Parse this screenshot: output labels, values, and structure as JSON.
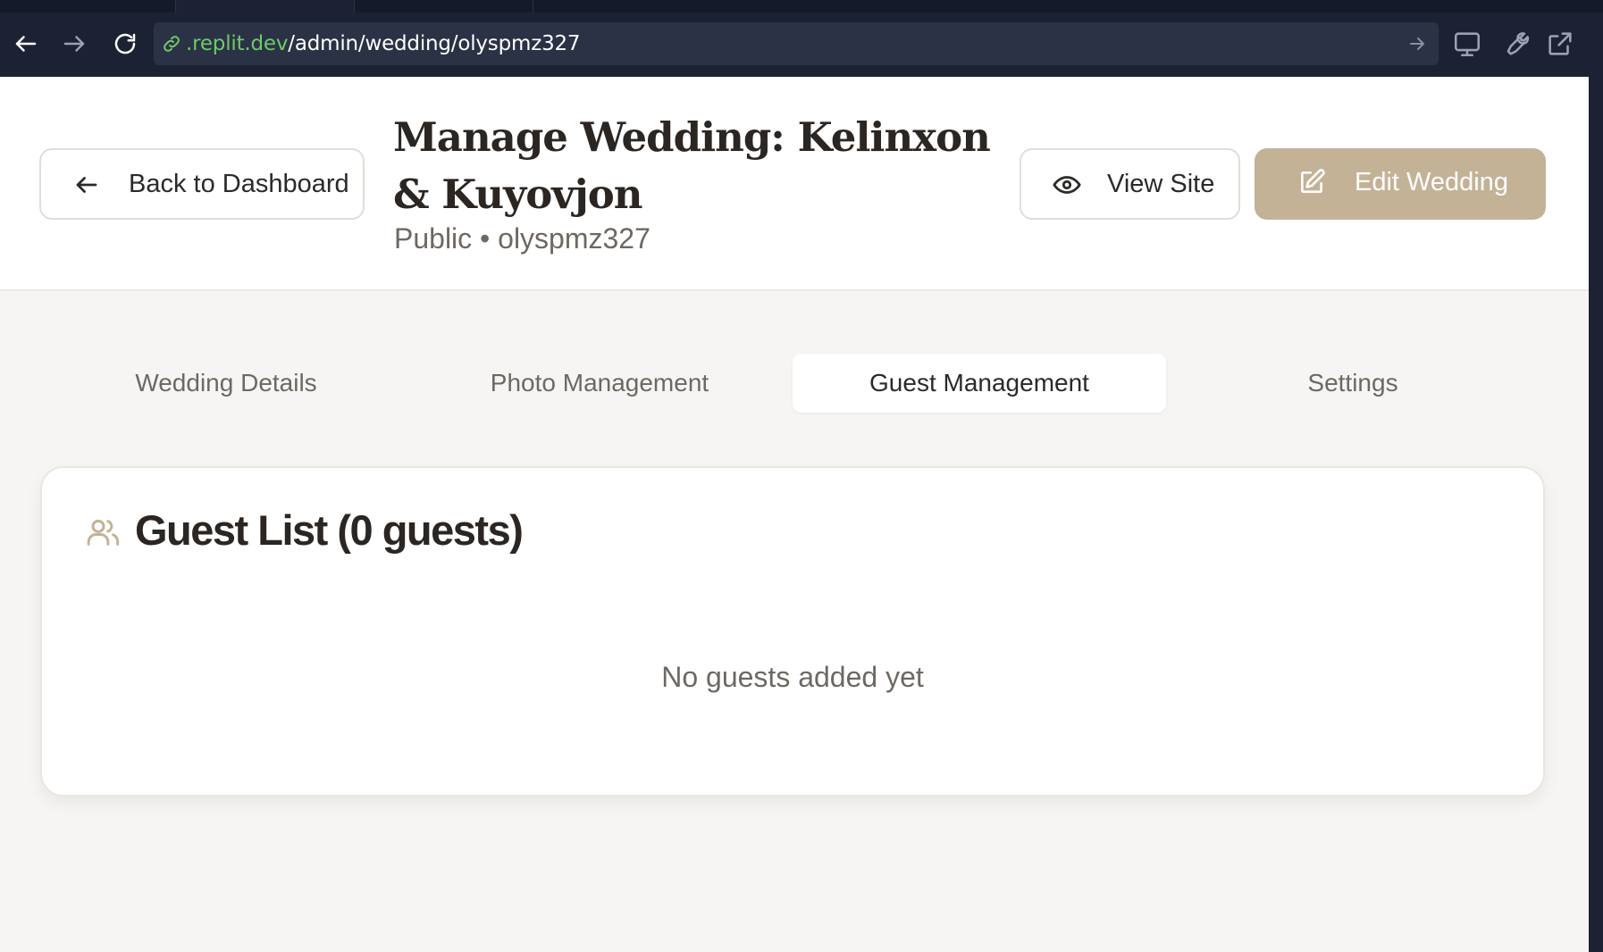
{
  "browser": {
    "url_domain": ".replit.dev",
    "url_path": "/admin/wedding/olyspmz327",
    "icons": [
      "back-arrow-icon",
      "forward-arrow-icon",
      "reload-icon",
      "link-icon",
      "go-arrow-icon",
      "monitor-icon",
      "wrench-icon",
      "external-link-icon"
    ]
  },
  "header": {
    "back_label": "Back to Dashboard",
    "title": "Manage Wedding: Kelinxon & Kuyovjon",
    "subtitle": "Public • olyspmz327",
    "view_site_label": "View Site",
    "edit_label": "Edit Wedding"
  },
  "tabs": [
    {
      "label": "Wedding Details",
      "active": false
    },
    {
      "label": "Photo Management",
      "active": false
    },
    {
      "label": "Guest Management",
      "active": true
    },
    {
      "label": "Settings",
      "active": false
    }
  ],
  "guest_list": {
    "title": "Guest List (0 guests)",
    "empty_message": "No guests added yet"
  },
  "colors": {
    "accent": "#c4b297",
    "chrome_bg": "#1c2233",
    "page_bg": "#f7f5f3",
    "url_domain": "#6ec96a"
  }
}
